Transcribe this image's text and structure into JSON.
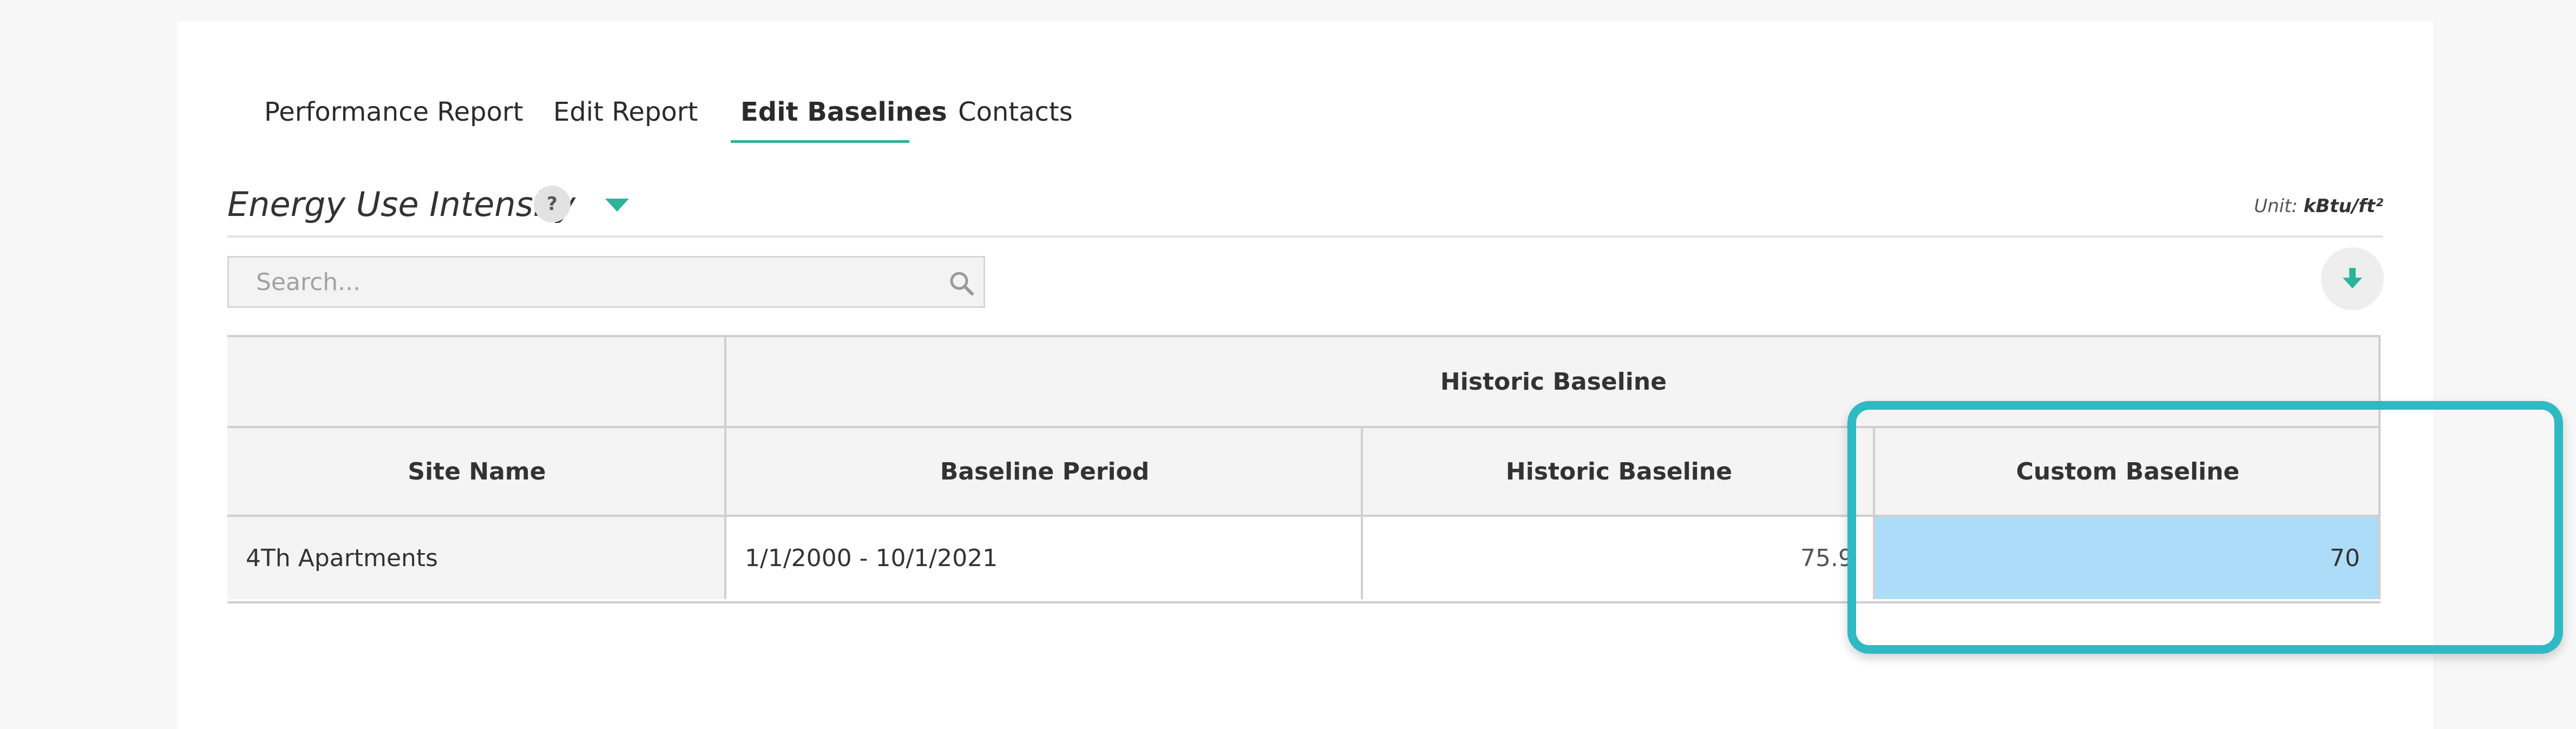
{
  "tabs": [
    {
      "label": "Performance Report",
      "active": false
    },
    {
      "label": "Edit Report",
      "active": false
    },
    {
      "label": "Edit Baselines",
      "active": true
    },
    {
      "label": "Contacts",
      "active": false
    }
  ],
  "metric": {
    "title": "Energy Use Intensity",
    "help": "?",
    "unit_label": "Unit:",
    "unit_value": "kBtu/ft²"
  },
  "search": {
    "placeholder": "Search...",
    "value": ""
  },
  "table": {
    "group_header": "Historic Baseline",
    "columns": [
      "Site Name",
      "Baseline Period",
      "Historic Baseline",
      "Custom Baseline"
    ],
    "rows": [
      {
        "site": "4Th Apartments",
        "period": "1/1/2000 - 10/1/2021",
        "historic": "75.9",
        "custom": "70"
      }
    ]
  },
  "colors": {
    "accent": "#2bb39b",
    "highlight_cell": "#addcf8",
    "callout_border": "#2fb9c2"
  }
}
